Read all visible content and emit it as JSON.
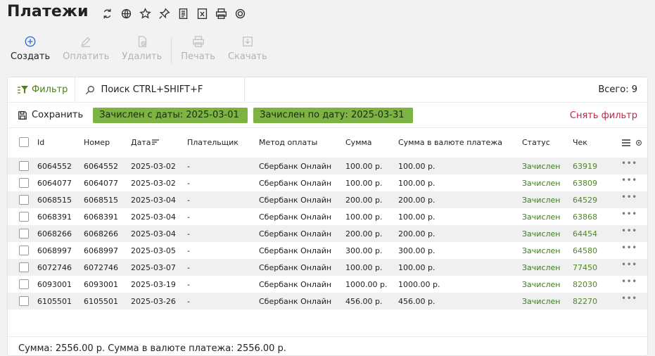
{
  "page": {
    "title": "Платежи"
  },
  "title_icons": [
    "refresh-icon",
    "globe-icon",
    "star-icon",
    "pin-icon",
    "document-icon",
    "excel-icon",
    "printer-icon",
    "lifebuoy-icon"
  ],
  "toolbar": {
    "create": "Создать",
    "pay": "Оплатить",
    "delete": "Удалить",
    "print": "Печать",
    "download": "Скачать"
  },
  "filter_bar": {
    "filter_label": "Фильтр",
    "search_placeholder": "Поиск CTRL+SHIFT+F",
    "total": "Всего: 9"
  },
  "action_bar": {
    "save_label": "Сохранить",
    "chip_from": "Зачислен с даты: 2025-03-01",
    "chip_to": "Зачислен по дату: 2025-03-31",
    "clear_filter": "Снять фильтр"
  },
  "colors": {
    "accent_green": "#7cb342",
    "status_green": "#3f7d1e",
    "clear_red": "#c0264a",
    "create_blue": "#2a6fd6"
  },
  "table": {
    "columns": {
      "id": "Id",
      "number": "Номер",
      "date": "Дата",
      "payer": "Плательщик",
      "method": "Метод оплаты",
      "sum": "Сумма",
      "sum_currency": "Сумма в валюте платежа",
      "status": "Статус",
      "check": "Чек"
    },
    "rows": [
      {
        "id": "6064552",
        "number": "6064552",
        "date": "2025-03-02",
        "payer": "-",
        "method": "Сбербанк Онлайн",
        "sum": "100.00 р.",
        "sum_currency": "100.00 р.",
        "status": "Зачислен",
        "check": "63919",
        "more": "•••"
      },
      {
        "id": "6064077",
        "number": "6064077",
        "date": "2025-03-02",
        "payer": "-",
        "method": "Сбербанк Онлайн",
        "sum": "100.00 р.",
        "sum_currency": "100.00 р.",
        "status": "Зачислен",
        "check": "63809",
        "more": "•••"
      },
      {
        "id": "6068515",
        "number": "6068515",
        "date": "2025-03-04",
        "payer": "-",
        "method": "Сбербанк Онлайн",
        "sum": "200.00 р.",
        "sum_currency": "200.00 р.",
        "status": "Зачислен",
        "check": "64529",
        "more": "•••"
      },
      {
        "id": "6068391",
        "number": "6068391",
        "date": "2025-03-04",
        "payer": "-",
        "method": "Сбербанк Онлайн",
        "sum": "100.00 р.",
        "sum_currency": "100.00 р.",
        "status": "Зачислен",
        "check": "63868",
        "more": "•••"
      },
      {
        "id": "6068266",
        "number": "6068266",
        "date": "2025-03-04",
        "payer": "-",
        "method": "Сбербанк Онлайн",
        "sum": "200.00 р.",
        "sum_currency": "200.00 р.",
        "status": "Зачислен",
        "check": "64454",
        "more": "•••"
      },
      {
        "id": "6068997",
        "number": "6068997",
        "date": "2025-03-05",
        "payer": "-",
        "method": "Сбербанк Онлайн",
        "sum": "300.00 р.",
        "sum_currency": "300.00 р.",
        "status": "Зачислен",
        "check": "64580",
        "more": "•••"
      },
      {
        "id": "6072746",
        "number": "6072746",
        "date": "2025-03-07",
        "payer": "-",
        "method": "Сбербанк Онлайн",
        "sum": "100.00 р.",
        "sum_currency": "100.00 р.",
        "status": "Зачислен",
        "check": "77450",
        "more": "•••"
      },
      {
        "id": "6093001",
        "number": "6093001",
        "date": "2025-03-19",
        "payer": "-",
        "method": "Сбербанк Онлайн",
        "sum": "1000.00 р.",
        "sum_currency": "1000.00 р.",
        "status": "Зачислен",
        "check": "82030",
        "more": "•••"
      },
      {
        "id": "6105501",
        "number": "6105501",
        "date": "2025-03-26",
        "payer": "-",
        "method": "Сбербанк Онлайн",
        "sum": "456.00 р.",
        "sum_currency": "456.00 р.",
        "status": "Зачислен",
        "check": "82270",
        "more": "•••"
      }
    ]
  },
  "footer": {
    "summary": "Сумма: 2556.00 р. Сумма в валюте платежа: 2556.00 р."
  }
}
